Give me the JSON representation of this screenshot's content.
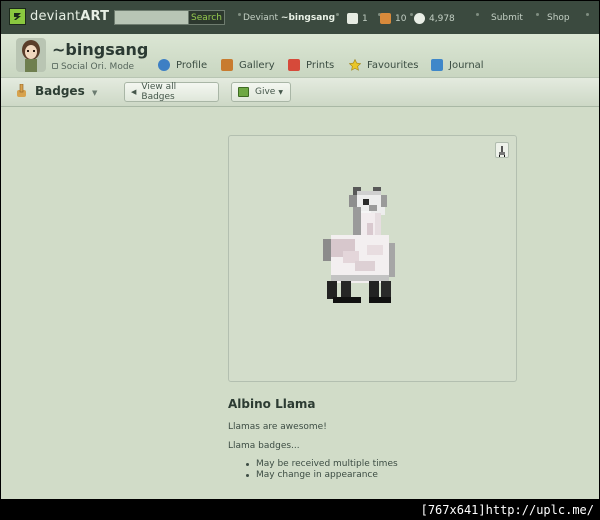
{
  "topbar": {
    "logo_text_a": "deviant",
    "logo_text_b": "ART",
    "search_placeholder": "",
    "search_button": "Search",
    "deviant_prefix": "Deviant",
    "deviant_username": "~bingsang",
    "count_notes": "1",
    "count_deviations": "10",
    "count_messages": "4,978",
    "submit": "Submit",
    "shop": "Shop"
  },
  "user": {
    "name": "~bingsang",
    "subtitle": "Social Ori. Mode"
  },
  "nav": {
    "profile": "Profile",
    "gallery": "Gallery",
    "prints": "Prints",
    "favourites": "Favourites",
    "journal": "Journal"
  },
  "toolbar": {
    "title": "Badges",
    "view_all": "View all Badges",
    "give": "Give"
  },
  "badge": {
    "name": "Albino Llama",
    "description": "Llamas are awesome!",
    "subheading": "Llama badges...",
    "features": [
      "May be received multiple times",
      "May change in appearance"
    ]
  },
  "watermark": "[767x641]http://uplc.me/",
  "colors": {
    "topbar_bg": "#3b4a3f",
    "page_bg": "#d1dcc8",
    "accent_green": "#95c94e"
  },
  "icons": {
    "logo": "deviantart-logo-icon",
    "notes": "notes-icon",
    "deviations": "deviations-icon",
    "messages": "messages-icon",
    "profile": "profile-icon",
    "gallery": "gallery-icon",
    "prints": "prints-icon",
    "favourites": "star-icon",
    "journal": "journal-icon",
    "badges": "badge-hand-icon",
    "give": "gift-icon",
    "corner": "llama-mini-icon"
  }
}
